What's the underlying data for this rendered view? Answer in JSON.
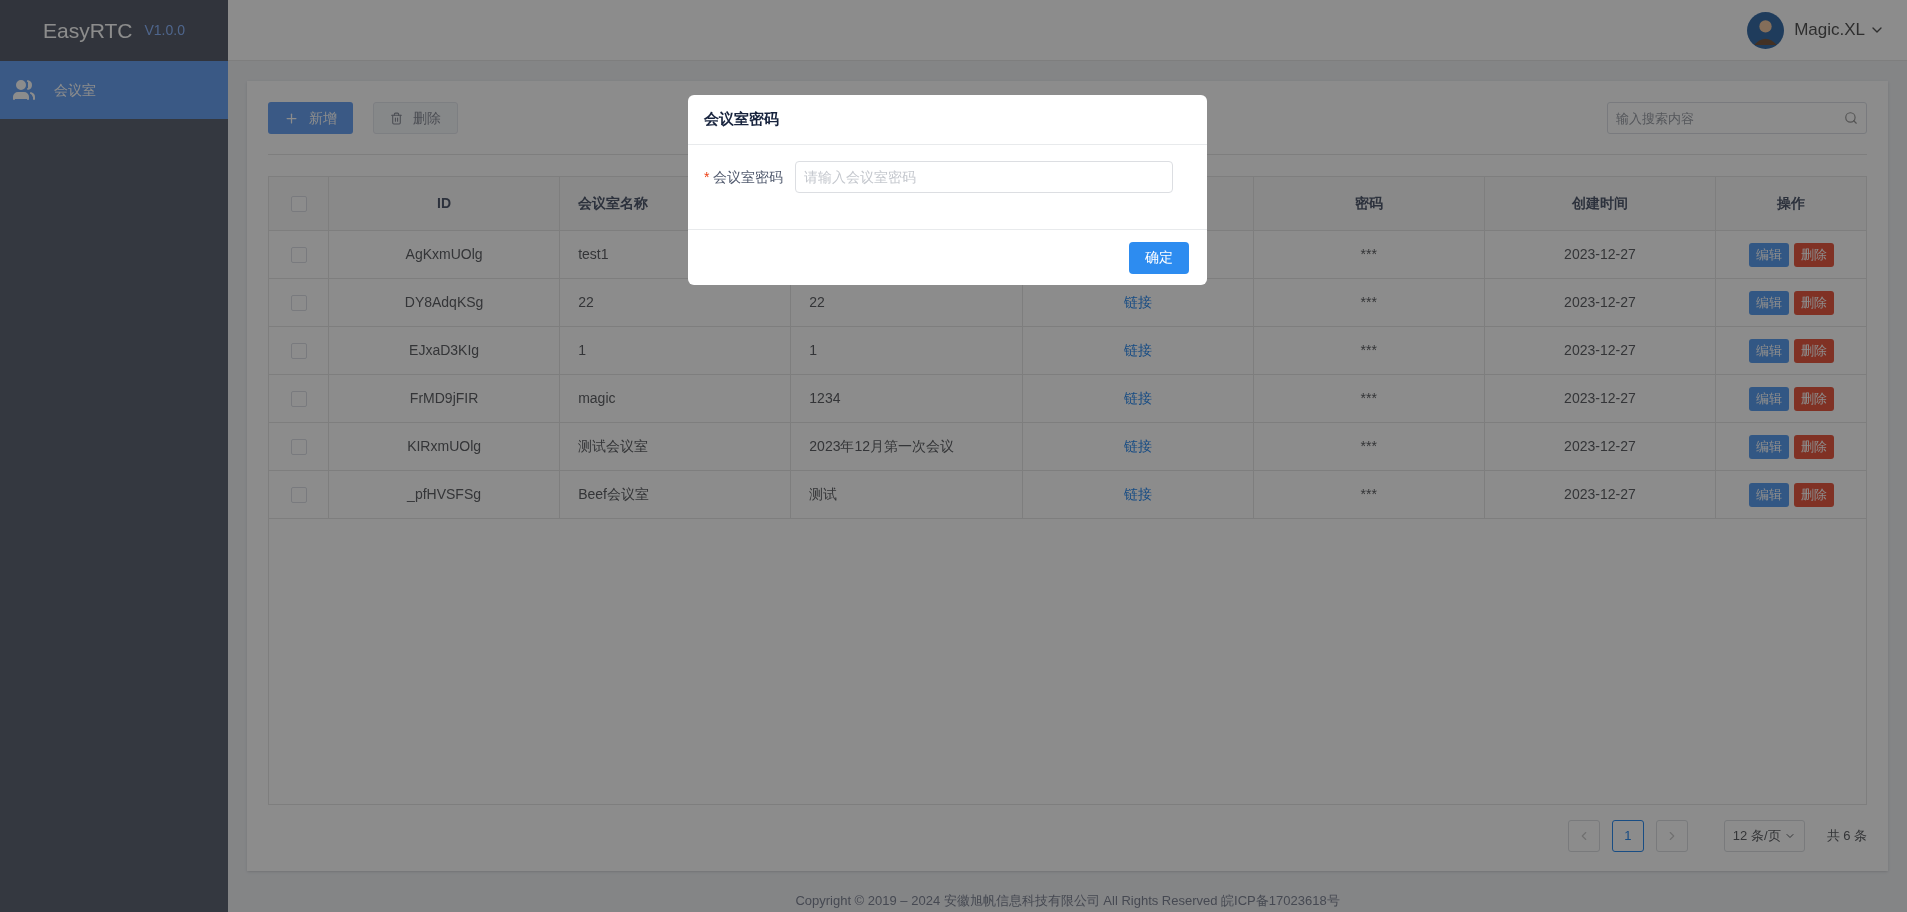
{
  "sidebar": {
    "logo": "EasyRTC",
    "version": "V1.0.0",
    "items": [
      {
        "label": "会议室",
        "selected": true
      }
    ]
  },
  "header": {
    "user": "Magic.XL"
  },
  "toolbar": {
    "add_button": "新增",
    "delete_button": {
      "label": "删除",
      "disabled": true
    },
    "search": {
      "placeholder": "输入搜索内容"
    }
  },
  "table": {
    "all_checked": false,
    "header": {
      "id": "ID",
      "name": "会议室名称",
      "password": "密码",
      "created": "创建时间",
      "actions": "操作"
    },
    "rows": [
      {
        "checked": false,
        "id": "AgKxmUOlg",
        "name": "test1",
        "password": "***",
        "created": "2023-12-27",
        "actions": [
          {
            "kind": "edit",
            "label": "编辑"
          },
          {
            "kind": "delete",
            "label": "删除"
          }
        ]
      },
      {
        "checked": false,
        "id": "DY8AdqKSg",
        "name": "22",
        "column_3": "22",
        "column_4": "链接",
        "password": "***",
        "created": "2023-12-27",
        "actions": [
          {
            "kind": "edit",
            "label": "编辑"
          },
          {
            "kind": "delete",
            "label": "删除"
          }
        ]
      },
      {
        "checked": false,
        "id": "EJxaD3KIg",
        "name": "1",
        "column_3": "1",
        "column_4": "链接",
        "password": "***",
        "created": "2023-12-27",
        "actions": [
          {
            "kind": "edit",
            "label": "编辑"
          },
          {
            "kind": "delete",
            "label": "删除"
          }
        ]
      },
      {
        "checked": false,
        "id": "FrMD9jFIR",
        "name": "magic",
        "column_3": "1234",
        "column_4": "链接",
        "password": "***",
        "created": "2023-12-27",
        "actions": [
          {
            "kind": "edit",
            "label": "编辑"
          },
          {
            "kind": "delete",
            "label": "删除"
          }
        ]
      },
      {
        "checked": false,
        "id": "KIRxmUOlg",
        "name": "测试会议室",
        "column_3": "2023年12月第一次会议",
        "column_4": "链接",
        "password": "***",
        "created": "2023-12-27",
        "actions": [
          {
            "kind": "edit",
            "label": "编辑"
          },
          {
            "kind": "delete",
            "label": "删除"
          }
        ]
      },
      {
        "checked": false,
        "id": "_pfHVSFSg",
        "name": "Beef会议室",
        "column_3": "测试",
        "column_4": "链接",
        "password": "***",
        "created": "2023-12-27",
        "actions": [
          {
            "kind": "edit",
            "label": "编辑"
          },
          {
            "kind": "delete",
            "label": "删除"
          }
        ]
      }
    ]
  },
  "pagination": {
    "pages": [
      {
        "label": "1",
        "selected": true
      }
    ],
    "page_size": "12 条/页",
    "total": "共 6 条"
  },
  "footer": "Copyright © 2019 – 2024 安徽旭帆信息科技有限公司 All Rights Reserved 皖ICP备17023618号",
  "dialog": {
    "title": "会议室密码",
    "field": {
      "label": "会议室密码",
      "required_mark": "*",
      "placeholder": "请输入会议室密码"
    },
    "confirm": "确定"
  }
}
